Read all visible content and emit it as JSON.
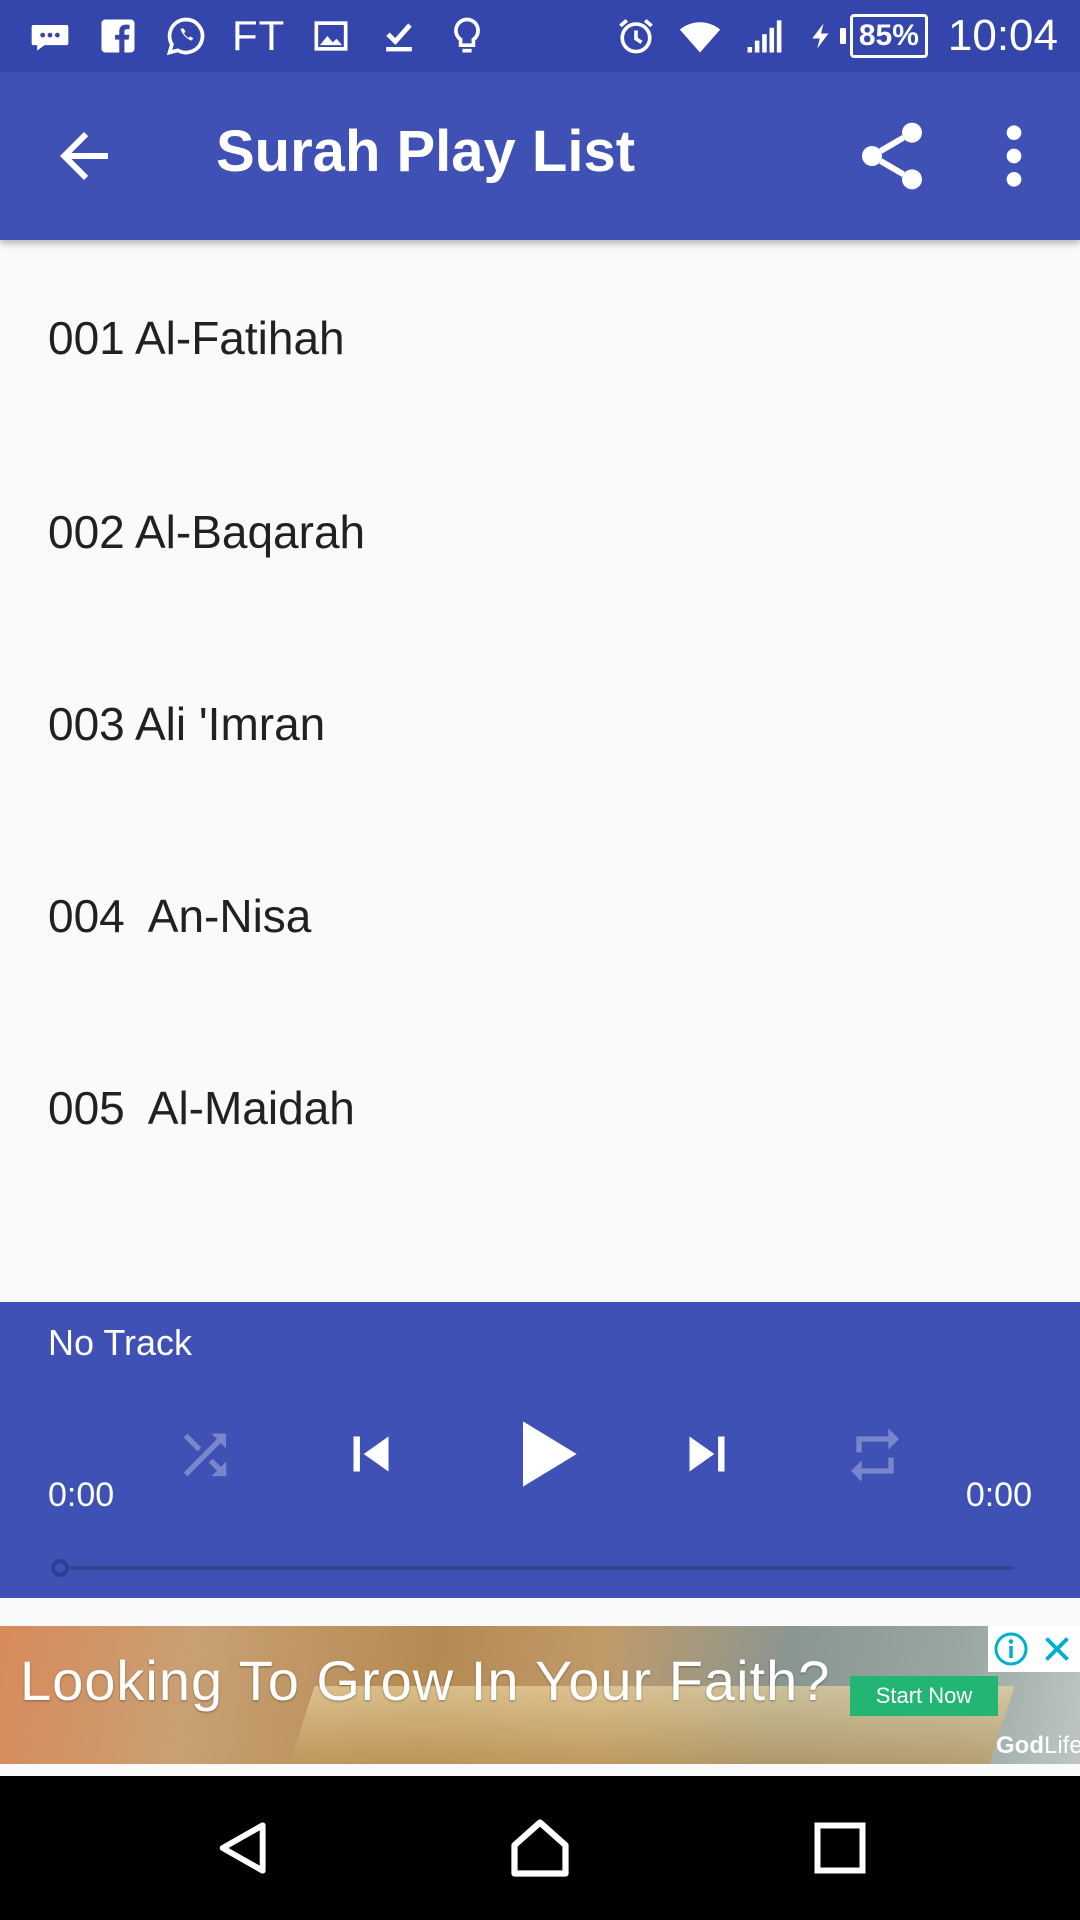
{
  "status_bar": {
    "carrier_text": "FT",
    "battery": "85%",
    "time": "10:04",
    "left_icons": [
      "messages-icon",
      "facebook-icon",
      "whatsapp-icon",
      "image-icon",
      "download-done-icon",
      "lightbulb-icon"
    ],
    "right_icons": [
      "alarm-icon",
      "wifi-icon",
      "signal-icon",
      "charging-icon"
    ]
  },
  "app_bar": {
    "title": "Surah Play List",
    "background": "#3f51b5"
  },
  "surahs": [
    "001 Al-Fatihah",
    "002 Al-Baqarah",
    "003 Ali 'Imran",
    "004  An-Nisa",
    "005  Al-Maidah"
  ],
  "player": {
    "track": "No Track",
    "current_time": "0:00",
    "total_time": "0:00",
    "progress": 0
  },
  "ad": {
    "text": "Looking To Grow In Your Faith?",
    "cta": "Start Now",
    "brand_bold": "God",
    "brand_rest": "Life"
  }
}
